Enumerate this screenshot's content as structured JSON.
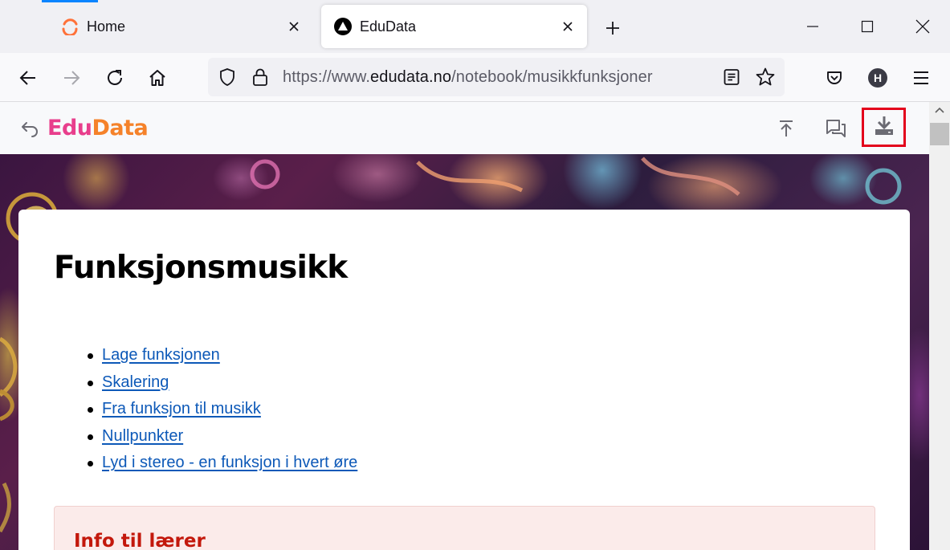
{
  "browser": {
    "tabs": [
      {
        "title": "Home",
        "active": false,
        "icon": "firefox-ring-icon"
      },
      {
        "title": "EduData",
        "active": true,
        "icon": "edudata-triangle-icon"
      }
    ],
    "url": {
      "prefix": "https://www.",
      "host": "edudata.no",
      "path": "/notebook/musikkfunksjoner"
    },
    "profile_initial": "H",
    "accent_color": "#0a84ff"
  },
  "site": {
    "logo_part1": "Edu",
    "logo_part2": "Data",
    "logo_colors": [
      "#e83e8c",
      "#f5822a"
    ],
    "highlight_color": "#e3001b"
  },
  "page": {
    "title": "Funksjonsmusikk",
    "toc": [
      "Lage funksjonen",
      "Skalering",
      "Fra funksjon til musikk",
      "Nullpunkter",
      "Lyd i stereo - en funksjon i hvert øre"
    ],
    "info_title": "Info til lærer",
    "link_color": "#0d59b8",
    "info_color": "#c3180c"
  }
}
